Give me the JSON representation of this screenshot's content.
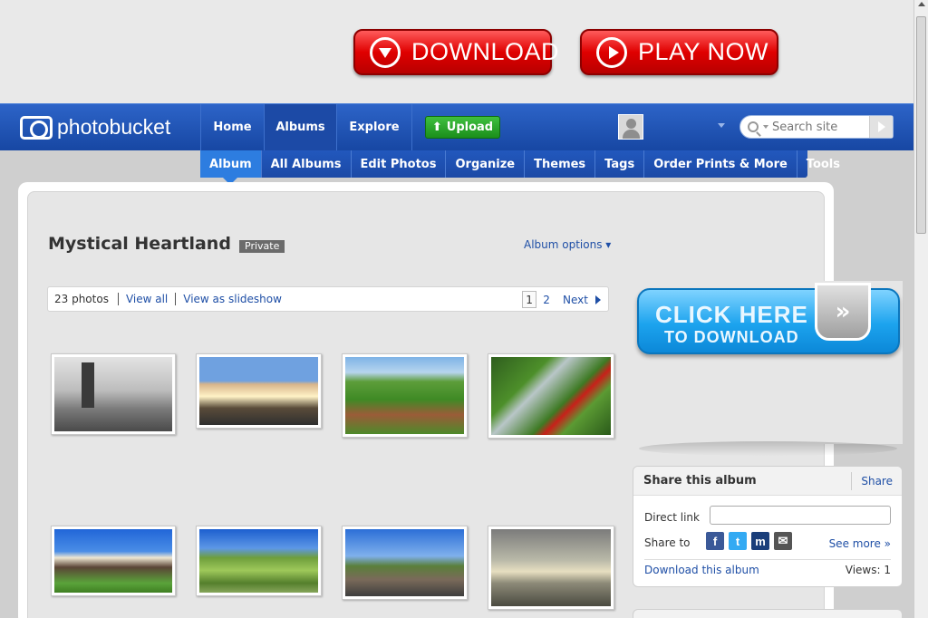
{
  "ads": {
    "download_label": "DOWNLOAD",
    "play_label": "PLAY NOW",
    "click_here_line1": "CLICK HERE",
    "click_here_line2": "TO DOWNLOAD",
    "click_here_icon": "»"
  },
  "header": {
    "logo_text": "photobucket",
    "tabs": [
      {
        "label": "Home"
      },
      {
        "label": "Albums"
      },
      {
        "label": "Explore"
      }
    ],
    "upload_label": "Upload",
    "upload_icon": "⬆",
    "search_placeholder": "Search site"
  },
  "subnav": {
    "items": [
      {
        "label": "Album"
      },
      {
        "label": "All Albums"
      },
      {
        "label": "Edit Photos"
      },
      {
        "label": "Organize"
      },
      {
        "label": "Themes"
      },
      {
        "label": "Tags"
      },
      {
        "label": "Order Prints & More"
      },
      {
        "label": "Tools"
      }
    ]
  },
  "album": {
    "title": "Mystical Heartland",
    "privacy": "Private",
    "options_label": "Album options ▾",
    "photo_count": "23 photos",
    "view_all": "View all",
    "view_slideshow": "View as slideshow",
    "pages": [
      "1",
      "2"
    ],
    "next_label": "Next"
  },
  "share": {
    "title": "Share this album",
    "share_link": "Share",
    "direct_link_label": "Direct link",
    "direct_link_value": "",
    "share_to_label": "Share to",
    "social": [
      {
        "icon": "facebook-icon",
        "glyph": "f",
        "color": "#3b5998"
      },
      {
        "icon": "twitter-icon",
        "glyph": "t",
        "color": "#33aaf3"
      },
      {
        "icon": "myspace-icon",
        "glyph": "m",
        "color": "#1a3e7a"
      },
      {
        "icon": "email-icon",
        "glyph": "✉",
        "color": "#555555"
      }
    ],
    "see_more": "See more »",
    "download_album": "Download this album",
    "views": "Views: 1"
  },
  "colors": {
    "nav_blue": "#1f56b8",
    "link_blue": "#1f4fa6",
    "ad_red": "#e00000",
    "ad_cyan": "#1ca3ee"
  }
}
